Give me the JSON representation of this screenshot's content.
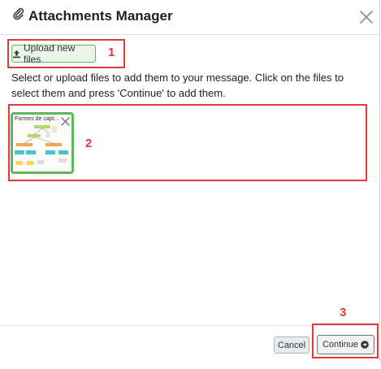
{
  "modal": {
    "title": "Attachments Manager",
    "title_icon": "paperclip-icon",
    "close_icon": "close-icon"
  },
  "upload": {
    "label": "Upload new files",
    "icon": "upload-icon"
  },
  "instructions": "Select or upload files to add them to your message. Click on the files to select them and press 'Continue' to add them.",
  "files": [
    {
      "name": "Formes de capt...",
      "selected": true
    }
  ],
  "footer": {
    "cancel_label": "Cancel",
    "continue_label": "Continue",
    "continue_icon": "arrow-circle-right-icon"
  },
  "annotations": {
    "n1": "1",
    "n2": "2",
    "n3": "3"
  },
  "colors": {
    "annotation": "#e53935",
    "selected_border": "#5cb85c",
    "upload_bg": "#e9f5e7"
  }
}
